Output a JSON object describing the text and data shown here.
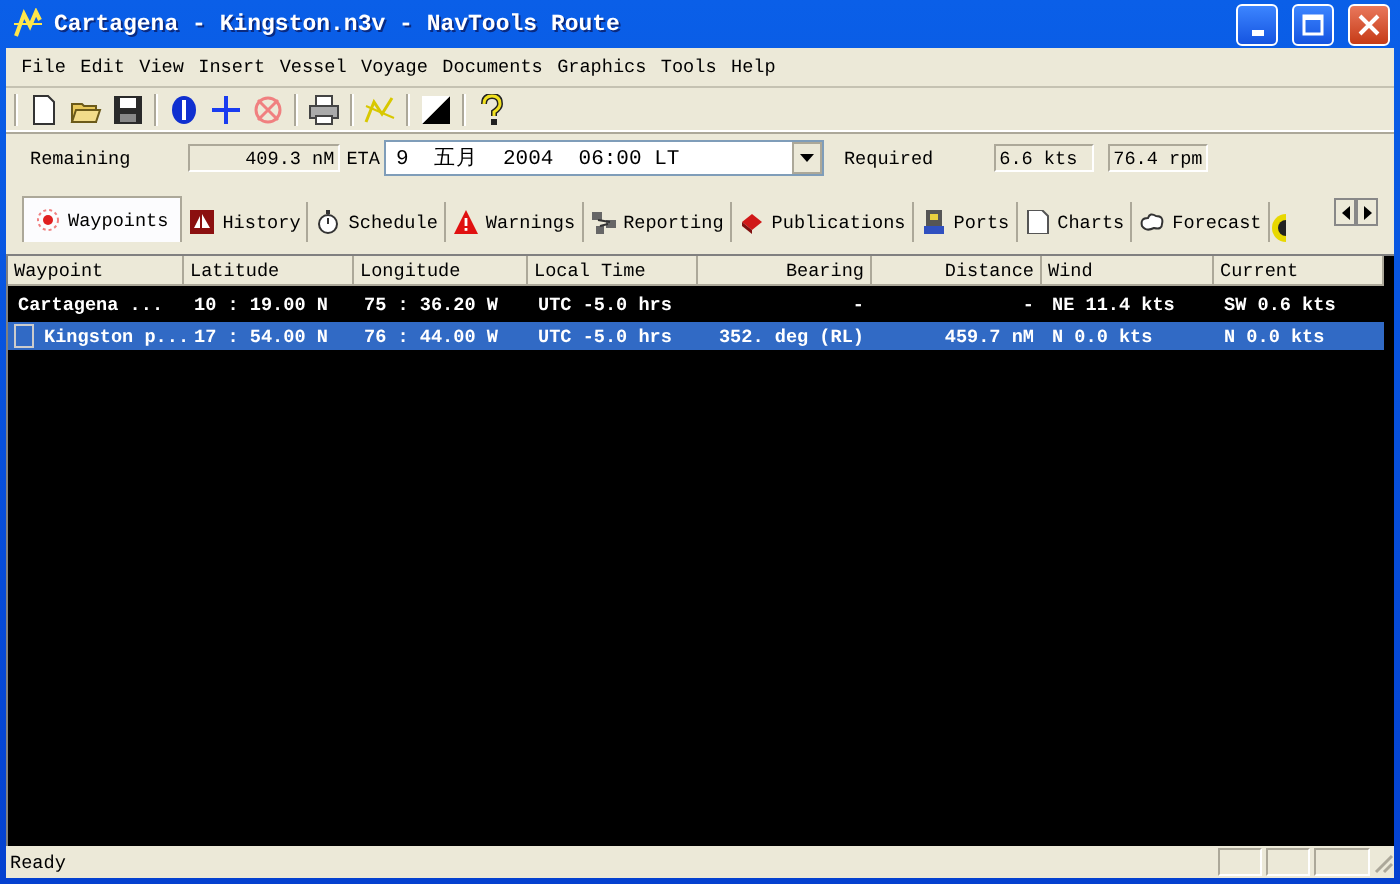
{
  "window": {
    "title": "Cartagena - Kingston.n3v - NavTools Route"
  },
  "menu": [
    "File",
    "Edit",
    "View",
    "Insert",
    "Vessel",
    "Voyage",
    "Documents",
    "Graphics",
    "Tools",
    "Help"
  ],
  "voyage": {
    "remaining_label": "Remaining",
    "remaining": "409.3 nM",
    "eta_label": "ETA",
    "eta": "9  五月  2004  06:00 LT",
    "required_label": "Required",
    "speed": "6.6 kts",
    "rpm": "76.4 rpm"
  },
  "tabs": [
    {
      "label": "Waypoints",
      "selected": true
    },
    {
      "label": "History",
      "selected": false
    },
    {
      "label": "Schedule",
      "selected": false
    },
    {
      "label": "Warnings",
      "selected": false
    },
    {
      "label": "Reporting",
      "selected": false
    },
    {
      "label": "Publications",
      "selected": false
    },
    {
      "label": "Ports",
      "selected": false
    },
    {
      "label": "Charts",
      "selected": false
    },
    {
      "label": "Forecast",
      "selected": false
    }
  ],
  "table": {
    "columns": [
      "Waypoint",
      "Latitude",
      "Longitude",
      "Local Time",
      "Bearing",
      "Distance",
      "Wind",
      "Current"
    ],
    "rows": [
      {
        "cells": [
          "Cartagena ...",
          "10 : 19.00 N",
          "75 : 36.20 W",
          "UTC -5.0 hrs",
          "-",
          "-",
          "NE 11.4 kts",
          "SW 0.6 kts"
        ],
        "selected": false
      },
      {
        "cells": [
          "Kingston p...",
          "17 : 54.00 N",
          "76 : 44.00 W",
          "UTC -5.0 hrs",
          "352. deg (RL)",
          "459.7 nM",
          "N 0.0 kts",
          "N 0.0 kts"
        ],
        "selected": true
      }
    ]
  },
  "status_bar": {
    "text": "Ready"
  }
}
